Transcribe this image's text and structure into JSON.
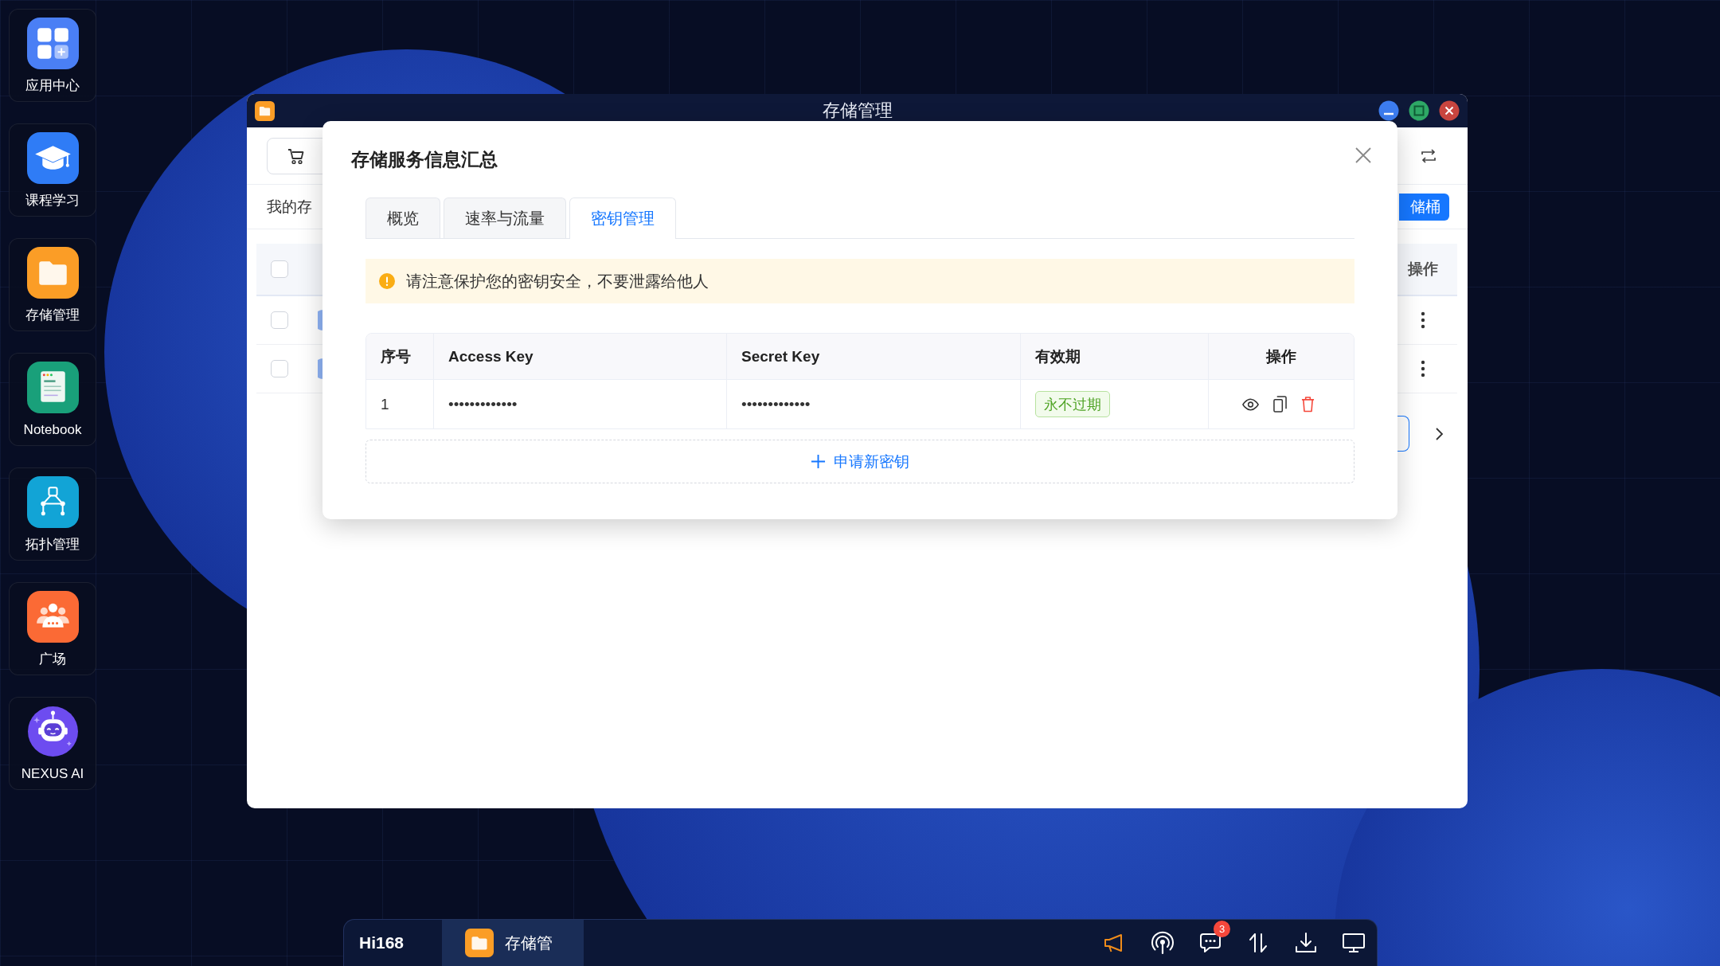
{
  "dock": [
    {
      "kind": "apps",
      "label": "应用中心"
    },
    {
      "kind": "course",
      "label": "课程学习"
    },
    {
      "kind": "storage",
      "label": "存储管理"
    },
    {
      "kind": "notebook",
      "label": "Notebook"
    },
    {
      "kind": "topology",
      "label": "拓扑管理"
    },
    {
      "kind": "plaza",
      "label": "广场"
    },
    {
      "kind": "robot",
      "label": "NEXUS AI"
    }
  ],
  "window": {
    "title": "存储管理"
  },
  "background_page": {
    "section_title": "我的存",
    "create_button": "储桶",
    "table": {
      "header_checked": false,
      "action_header": "操作",
      "rows": [
        {
          "checked": false
        },
        {
          "checked": false
        }
      ]
    }
  },
  "dialog": {
    "title": "存储服务信息汇总",
    "tabs": [
      {
        "label": "概览",
        "selected": false
      },
      {
        "label": "速率与流量",
        "selected": false
      },
      {
        "label": "密钥管理",
        "selected": true
      }
    ],
    "alert": "请注意保护您的密钥安全，不要泄露给他人",
    "table": {
      "columns": [
        "序号",
        "Access Key",
        "Secret Key",
        "有效期",
        "操作"
      ],
      "rows": [
        {
          "index": "1",
          "access_key": "•••••••••••••",
          "secret_key": "•••••••••••••",
          "validity": "永不过期"
        }
      ]
    },
    "add_button": "申请新密钥"
  },
  "taskbar": {
    "brand": "Hi168",
    "apps": [
      {
        "kind": "storage",
        "label": "存储管",
        "selected": true
      }
    ],
    "badge": "3"
  }
}
